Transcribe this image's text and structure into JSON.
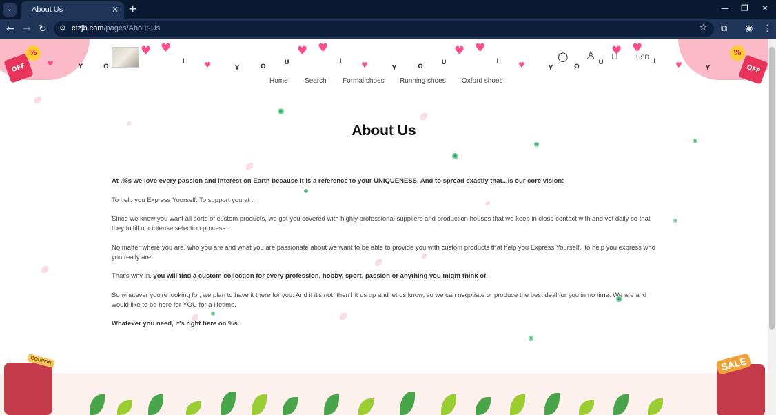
{
  "browser": {
    "tab_title": "About Us",
    "url_host": "ctzjb.com",
    "url_path": "/pages/About-Us"
  },
  "icons": {
    "tab_menu": "chevron-down-icon",
    "close": "close-icon",
    "new_tab": "plus-icon",
    "minimize": "minimize-icon",
    "restore": "restore-icon",
    "window_close": "window-close-icon",
    "back": "arrow-left-icon",
    "forward": "arrow-right-icon",
    "reload": "reload-icon",
    "site_info": "tune-icon",
    "bookmark": "star-icon",
    "extensions": "puzzle-icon",
    "profile": "profile-icon",
    "menu": "kebab-icon",
    "search": "search-icon",
    "account": "user-icon",
    "cart": "cart-icon"
  },
  "decor": {
    "off_label": "OFF",
    "percent": "%",
    "bunting_letters": [
      "Y",
      "O",
      "U",
      "I",
      "Y",
      "O",
      "U",
      "I",
      "Y",
      "O",
      "U",
      "I",
      "Y",
      "O",
      "U",
      "I",
      "Y"
    ],
    "coupon": "COUPON",
    "sale": "SALE",
    "off_small": "OFF"
  },
  "header": {
    "currency": "USD",
    "nav": [
      {
        "label": "Home"
      },
      {
        "label": "Search"
      },
      {
        "label": "Formal shoes"
      },
      {
        "label": "Running shoes"
      },
      {
        "label": "Oxford shoes"
      }
    ]
  },
  "page": {
    "title": "About Us",
    "p1": "At .%s we love every passion and interest on Earth because it is a reference to your UNIQUENESS. And to spread exactly that...is our core vision:",
    "p2": "To help you Express Yourself. To support you at .,",
    "p3": "Since we know you want all sorts of custom products, we got you covered with highly professional suppliers and production houses that we keep in close contact with and vet daily so that they fulfill our intense selection process.",
    "p4": "No matter where you are, who you are and what you are passionate about we want to be able to provide you with custom products that help you Express Yourself...to help you express who you really are!",
    "p5_prefix": "That's why in. ",
    "p5_bold": "you will find a custom collection for every profession, hobby, sport, passion or anything you might think of.",
    "p6": "So whatever you're looking for, we plan to have it there for you. And if it's not, then hit us up and let us know, so we can negotiate or produce the best deal for you in no time. We are and would like to be here for YOU for a lifetime.",
    "p7": "Whatever you need, it's right here on.%s."
  },
  "colors": {
    "chrome_dark": "#0b1a33",
    "chrome_toolbar": "#1f3557",
    "heart": "#ff4f8b",
    "off_tag": "#e8345b",
    "clover": "#39b06a"
  }
}
